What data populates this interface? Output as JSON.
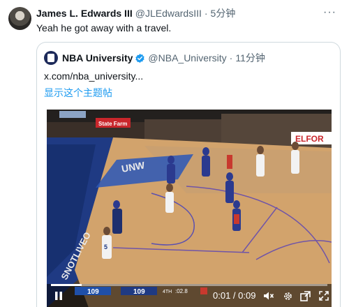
{
  "tweet": {
    "author_name": "James L. Edwards III",
    "author_handle": "@JLEdwardsIII",
    "separator": "·",
    "time": "5分钟",
    "text": "Yeah he got away with a travel.",
    "more_icon": "more-horizontal-icon"
  },
  "quoted": {
    "author_name": "NBA University",
    "verified_icon": "verified-badge-icon",
    "verified_color": "#1d9bf0",
    "author_handle": "@NBA_University",
    "separator": "·",
    "time": "11分钟",
    "text": "x.com/nba_university...",
    "show_thread": "显示这个主题帖"
  },
  "video": {
    "scoreboard": {
      "home_score": "109",
      "away_score": "109",
      "quarter": "4TH",
      "clock": ":02.8"
    },
    "jersey_number": "5",
    "arena_banner_left": "State Farm",
    "arena_banner_right": "ELFOR",
    "floor_text_1": "UNW",
    "floor_text_2": "SNOTLIVEO",
    "player": {
      "progress": 0.11,
      "time_display": "0:01 / 0:09",
      "play_icon": "pause-icon",
      "mute_icon": "volume-muted-icon",
      "settings_icon": "gear-icon",
      "popout_icon": "popout-icon",
      "fullscreen_icon": "fullscreen-icon"
    }
  },
  "colors": {
    "link": "#1d9bf0",
    "muted_text": "#536471",
    "border": "#cfd9de"
  }
}
